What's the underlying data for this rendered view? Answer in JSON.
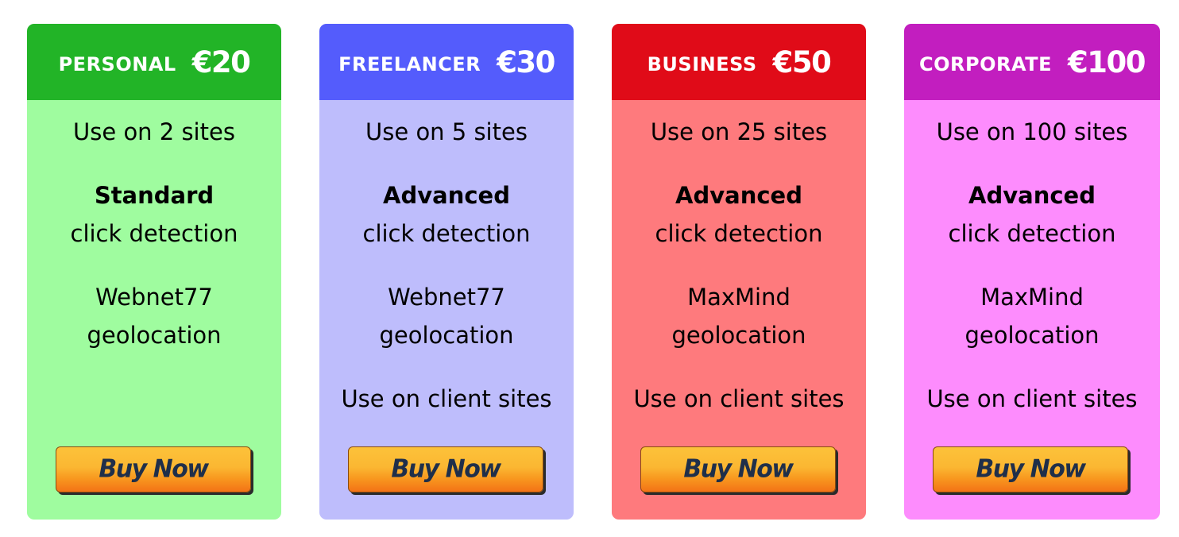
{
  "plans": [
    {
      "name": "PERSONAL",
      "price": "€20",
      "header_color": "#22b427",
      "body_color": "#9ffc9f",
      "sites": "Use on 2 sites",
      "detection_level": "Standard",
      "detection_label": "click detection",
      "geo_provider": "Webnet77",
      "geo_label": "geolocation",
      "client_sites": "",
      "button_label": "Buy Now"
    },
    {
      "name": "FREELANCER",
      "price": "€30",
      "header_color": "#545cfc",
      "body_color": "#bebdfc",
      "sites": "Use on 5 sites",
      "detection_level": "Advanced",
      "detection_label": "click detection",
      "geo_provider": "Webnet77",
      "geo_label": "geolocation",
      "client_sites": "Use on client sites",
      "button_label": "Buy Now"
    },
    {
      "name": "BUSINESS",
      "price": "€50",
      "header_color": "#e00b18",
      "body_color": "#fe7a7d",
      "sites": "Use on 25 sites",
      "detection_level": "Advanced",
      "detection_label": "click detection",
      "geo_provider": "MaxMind",
      "geo_label": "geolocation",
      "client_sites": "Use on client sites",
      "button_label": "Buy Now"
    },
    {
      "name": "CORPORATE",
      "price": "€100",
      "header_color": "#c21ebf",
      "body_color": "#fd8cfd",
      "sites": "Use on 100 sites",
      "detection_level": "Advanced",
      "detection_label": "click detection",
      "geo_provider": "MaxMind",
      "geo_label": "geolocation",
      "client_sites": "Use on client sites",
      "button_label": "Buy Now"
    }
  ]
}
